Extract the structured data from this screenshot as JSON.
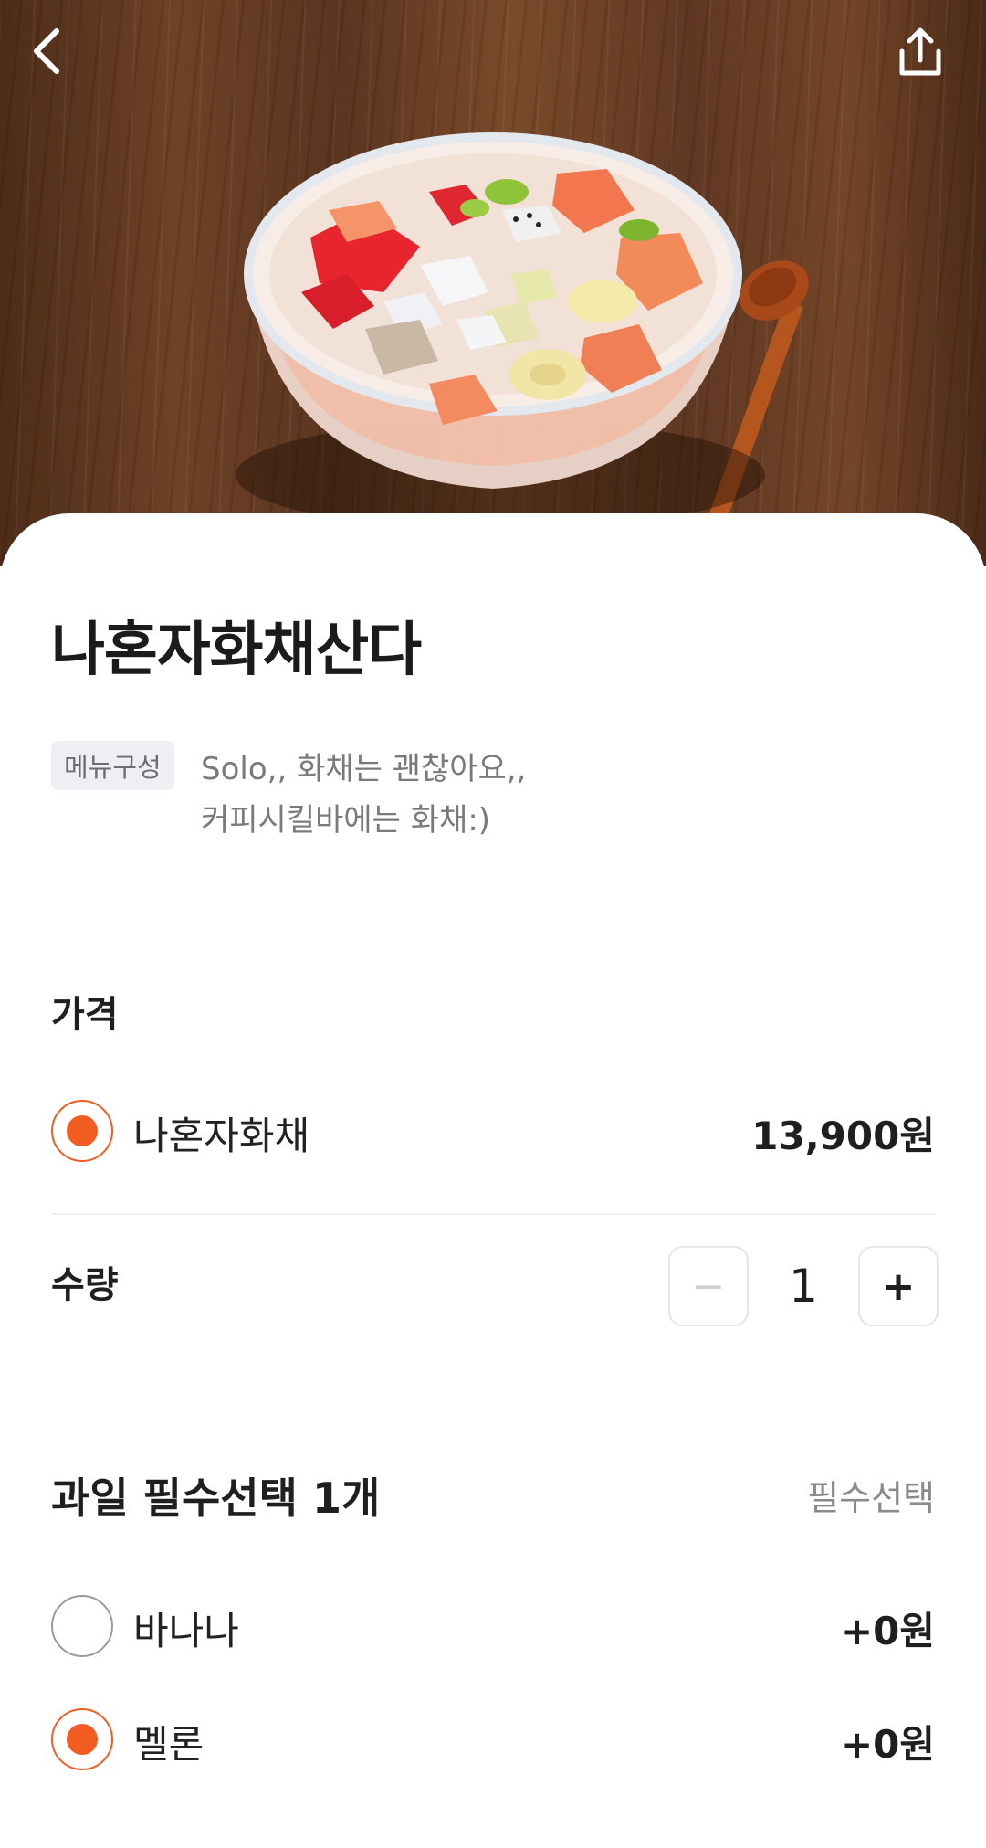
{
  "header": {
    "back_icon": "chevron-left-icon",
    "share_icon": "share-icon"
  },
  "hero": {
    "image_alt": "bowl-of-hwachae-fruit-punch"
  },
  "product": {
    "title": "나혼자화채산다",
    "menu_tag": "메뉴구성",
    "description_line1": "Solo,, 화채는 괜찮아요,,",
    "description_line2": "커피시킬바에는 화채:)"
  },
  "price_section": {
    "label": "가격",
    "option": {
      "label": "나혼자화채",
      "price": "13,900원",
      "selected": true
    }
  },
  "quantity": {
    "label": "수량",
    "minus": "−",
    "value": "1",
    "plus": "+"
  },
  "fruit_section": {
    "title": "과일 필수선택 1개",
    "required": "필수선택",
    "options": [
      {
        "label": "바나나",
        "price": "+0원",
        "selected": false
      },
      {
        "label": "멜론",
        "price": "+0원",
        "selected": true
      }
    ]
  },
  "colors": {
    "accent": "#f25c21",
    "text_primary": "#1f1f1f",
    "text_secondary": "#7a7a7a"
  }
}
